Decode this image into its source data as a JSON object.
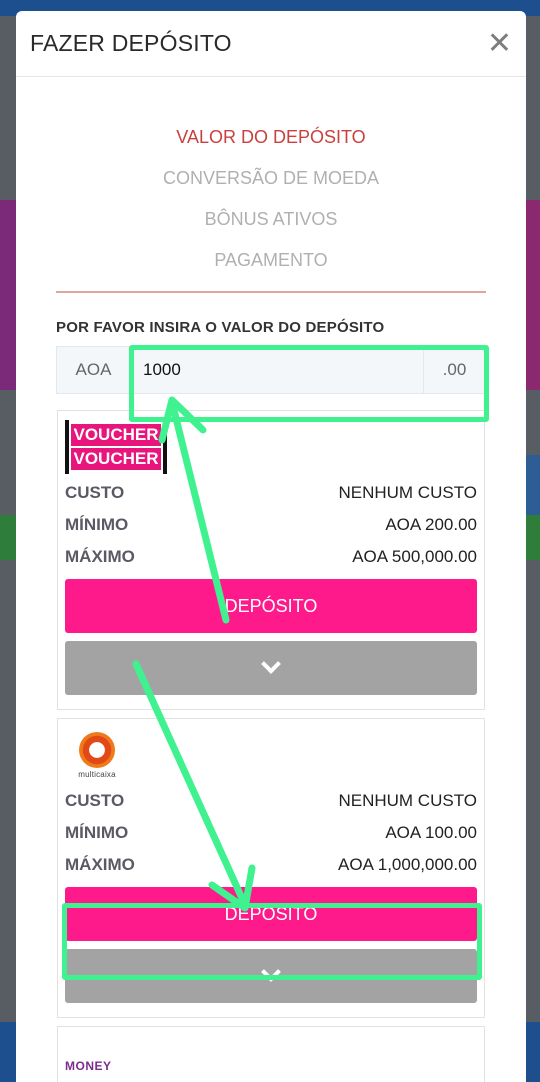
{
  "modal": {
    "title": "FAZER DEPÓSITO",
    "close_icon": "close-icon"
  },
  "steps": [
    {
      "label": "VALOR DO DEPÓSITO",
      "active": true
    },
    {
      "label": "CONVERSÃO DE MOEDA",
      "active": false
    },
    {
      "label": "BÔNUS ATIVOS",
      "active": false
    },
    {
      "label": "PAGAMENTO",
      "active": false
    }
  ],
  "amount": {
    "label": "POR FAVOR INSIRA O VALOR DO DEPÓSITO",
    "currency": "AOA",
    "value": "1000",
    "decimals": ".00"
  },
  "methods": [
    {
      "logo_lines": [
        "VOUCHER",
        "VOUCHER"
      ],
      "rows": [
        {
          "key": "CUSTO",
          "value": "NENHUM CUSTO"
        },
        {
          "key": "MÍNIMO",
          "value": "AOA 200.00"
        },
        {
          "key": "MÁXIMO",
          "value": "AOA 500,000.00"
        }
      ],
      "button": "DEPÓSITO"
    },
    {
      "logo_text": "multicaixa",
      "rows": [
        {
          "key": "CUSTO",
          "value": "NENHUM CUSTO"
        },
        {
          "key": "MÍNIMO",
          "value": "AOA 100.00"
        },
        {
          "key": "MÁXIMO",
          "value": "AOA 1,000,000.00"
        }
      ],
      "button": "DEPÓSITO"
    },
    {
      "logo_text": "MONEY"
    }
  ],
  "colors": {
    "active_step": "#c9403e",
    "deposit_button": "#ff1a8c",
    "expand_button": "#a3a3a3",
    "annotation": "#3ff28f"
  }
}
